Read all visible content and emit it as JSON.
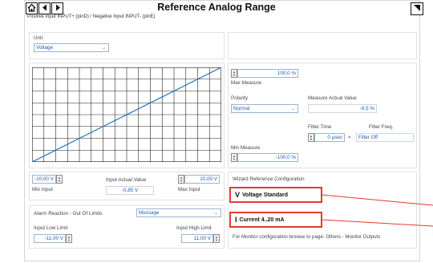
{
  "header": {
    "title": "Reference Analog Range",
    "subtitle": "Positive input INPUT+ (pinD) / Negative Input INPUT- (pinE)"
  },
  "unit": {
    "label": "Unit",
    "value": "Voltage"
  },
  "measure": {
    "max_value": "100,0 %",
    "max_label": "Max Measure",
    "polarity_label": "Polarity",
    "polarity_value": "Normal",
    "actual_label": "Measure Actual Value",
    "actual_value": "-8,5 %",
    "filter_time_label": "Filter Time",
    "filter_time_value": "0 µsec",
    "equals": "=",
    "filter_freq_label": "Filter Freq.",
    "filter_freq_value": "Filter Off",
    "min_label": "Min Measure",
    "min_value": "-100,0 %"
  },
  "input": {
    "min_value": "-10,00 V",
    "min_label": "Min Input",
    "actual_label": "Input Actual Value",
    "actual_value": "-0,85 V",
    "max_value": "10,00 V",
    "max_label": "Max Input"
  },
  "alarm": {
    "label": "Alarm Reaction - Out Of Limits",
    "value": "Message",
    "low_label": "Input  Low Limit",
    "low_value": "-11,00 V",
    "high_label": "Input High Limit",
    "high_value": "11,00 V"
  },
  "wizard": {
    "title": "Wizard Reference Configuration",
    "voltage_btn": "Voltage Standard",
    "current_btn": "Current 4..20 mA",
    "monitor_note": "For Monitor configuration browse to page: Others - Monitor Outputs"
  },
  "chart_data": {
    "type": "line",
    "x": [
      -10,
      10
    ],
    "y": [
      -100,
      100
    ],
    "grid": true,
    "series_color": "#1f6fc0"
  }
}
